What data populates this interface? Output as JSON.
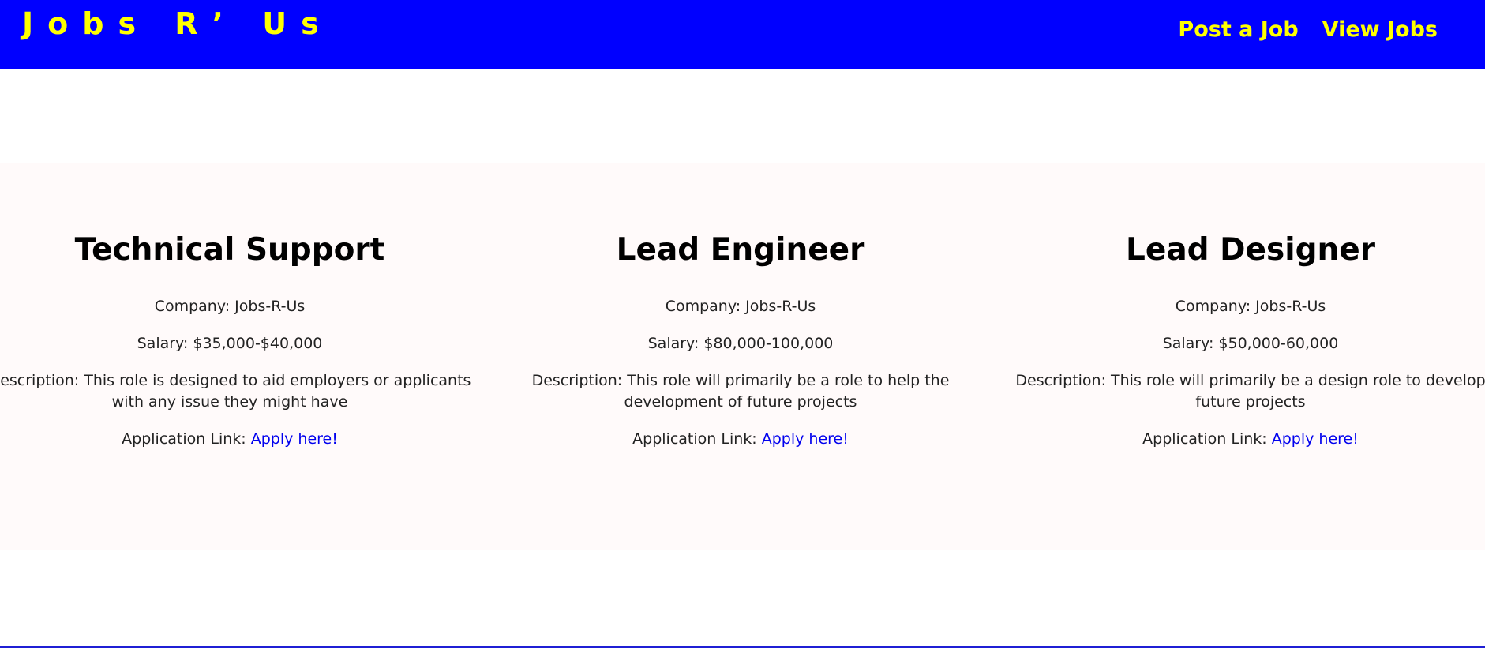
{
  "header": {
    "brand": "Jobs R’ Us",
    "nav": {
      "post_job": "Post a Job",
      "view_jobs": "View Jobs"
    }
  },
  "jobs": [
    {
      "title": "Technical Support",
      "company_prefix": "Company: ",
      "company": "Jobs-R-Us",
      "salary_prefix": "Salary: ",
      "salary": "$35,000-$40,000",
      "description_prefix": "Description: ",
      "description": "This role is designed to aid employers or applicants with any issue they might have",
      "application_prefix": "Application Link: ",
      "apply_label": "Apply here!"
    },
    {
      "title": "Lead Engineer",
      "company_prefix": "Company: ",
      "company": "Jobs-R-Us",
      "salary_prefix": "Salary: ",
      "salary": "$80,000-100,000",
      "description_prefix": "Description: ",
      "description": "This role will primarily be a role to help the development of future projects",
      "application_prefix": "Application Link: ",
      "apply_label": "Apply here!"
    },
    {
      "title": "Lead Designer",
      "company_prefix": "Company: ",
      "company": "Jobs-R-Us",
      "salary_prefix": "Salary: ",
      "salary": "$50,000-60,000",
      "description_prefix": "Description: ",
      "description": "This role will primarily be a design role to develop future projects",
      "application_prefix": "Application Link: ",
      "apply_label": "Apply here!"
    }
  ],
  "colors": {
    "header_bg": "#0000ff",
    "header_text": "#ffff00",
    "section_bg": "#fffafa",
    "link": "#0000ee"
  }
}
